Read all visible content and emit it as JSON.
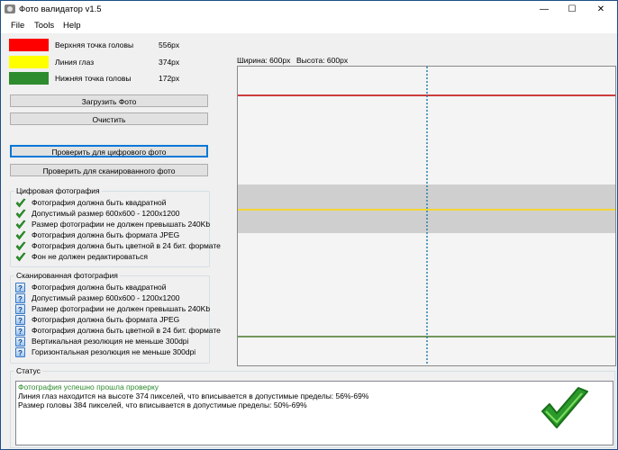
{
  "window": {
    "title": "Фото валидатор v1.5",
    "minimize": "—",
    "maximize": "☐",
    "close": "✕"
  },
  "menu": [
    "File",
    "Tools",
    "Help"
  ],
  "legend": [
    {
      "color": "#ff0000",
      "label": "Верхняя точка головы",
      "value": "556px"
    },
    {
      "color": "#ffff00",
      "label": "Линия глаз",
      "value": "374px"
    },
    {
      "color": "#2e8b2e",
      "label": "Нижняя точка головы",
      "value": "172px"
    }
  ],
  "buttons": {
    "load": "Загрузить Фото",
    "clear": "Очистить",
    "check_digital": "Проверить для цифрового фото",
    "check_scanned": "Проверить для сканированного фото"
  },
  "digital_group": {
    "title": "Цифровая фотография",
    "items": [
      "Фотография должна быть квадратной",
      "Допустимый размер 600x600 - 1200x1200",
      "Размер фотографии не должен превышать 240Kb",
      "Фотография должна быть формата JPEG",
      "Фотография должна быть цветной в 24 бит. формате",
      "Фон не должен редактироваться"
    ]
  },
  "scanned_group": {
    "title": "Сканированная фотография",
    "items": [
      "Фотография должна быть квадратной",
      "Допустимый размер 600x600 - 1200x1200",
      "Размер фотографии не должен превышать 240Kb",
      "Фотография должна быть формата JPEG",
      "Фотография должна быть цветной в 24 бит. формате",
      "Вертикальная резолюция не меньше 300dpi",
      "Горизонтальная резолюция не меньше 300dpi"
    ]
  },
  "preview": {
    "width_label": "Ширина: 600px",
    "height_label": "Высота: 600px"
  },
  "status": {
    "title": "Статус",
    "lines": [
      {
        "text": "Фотография успешно прошла проверку",
        "color": "#2e8b2e"
      },
      {
        "text": "Линия глаз находится на высоте 374 пикселей, что вписывается в допустимые пределы: 56%-69%",
        "color": "#000000"
      },
      {
        "text": "Размер головы 384 пикселей, что вписывается в допустимые пределы: 50%-69%",
        "color": "#000000"
      }
    ]
  },
  "colors": {
    "accent": "#0078d7",
    "success": "#33a02c"
  },
  "icons": {
    "pass": "check-icon",
    "pending": "question-icon",
    "result": "success-check-icon"
  }
}
